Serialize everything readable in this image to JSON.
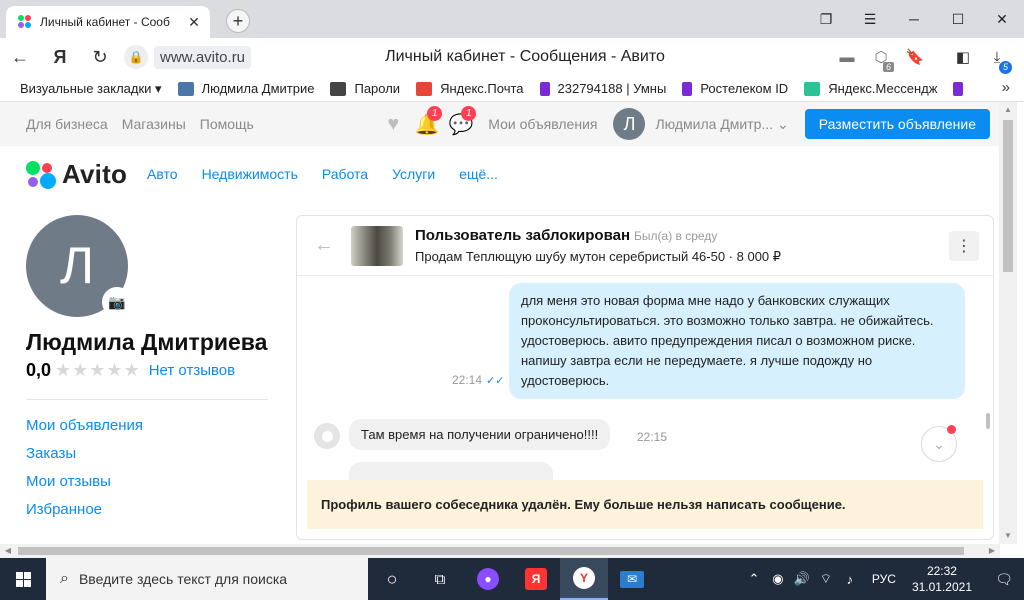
{
  "browser": {
    "tab_title": "Личный кабинет - Сооб",
    "domain": "www.avito.ru",
    "page_title": "Личный кабинет - Сообщения - Авито",
    "badge_6": "6",
    "badge_5": "5",
    "bookmarks": [
      {
        "label": "Визуальные закладки ▾",
        "color": ""
      },
      {
        "label": "Людмила Дмитрие",
        "color": "#4a76a8"
      },
      {
        "label": "Пароли",
        "color": "#444444"
      },
      {
        "label": "Яндекс.Почта",
        "color": "#e6453a"
      },
      {
        "label": "232794188 | Умны",
        "color": "#7b2bd6"
      },
      {
        "label": "Ростелеком ID",
        "color": "#7b2bd6"
      },
      {
        "label": "Яндекс.Мессендж",
        "color": "#2cc295"
      }
    ]
  },
  "avito": {
    "top_links": [
      "Для бизнеса",
      "Магазины",
      "Помощь"
    ],
    "fav_badge": "1",
    "msg_badge": "1",
    "my_ads": "Мои объявления",
    "avatar_letter": "Л",
    "user_name": "Людмила Дмитр...",
    "post_button": "Разместить объявление",
    "logo_text": "Avito",
    "categories": [
      "Авто",
      "Недвижимость",
      "Работа",
      "Услуги",
      "ещё..."
    ]
  },
  "profile": {
    "avatar_letter": "Л",
    "name": "Людмила Дмитриева",
    "rating": "0,0",
    "stars": "★★★★★",
    "reviews_link": "Нет отзывов",
    "menu": [
      "Мои объявления",
      "Заказы",
      "Мои отзывы",
      "Избранное"
    ]
  },
  "chat": {
    "title": "Пользователь заблокирован",
    "status": "Был(а) в среду",
    "subtitle": "Продам Теплющую шубу мутон серебристый 46-50 · 8 000 ₽",
    "out_message": "для меня это новая форма мне надо у банковских служащих проконсультироваться. это возможно только завтра. не обижайтесь. удостоверюсь. авито предупреждения писал о возможном риске. напишу завтра если не передумаете. я лучше подожду но удостоверюсь.",
    "out_time": "22:14",
    "in_message": "Там время на получении ограничено!!!!",
    "in_time": "22:15",
    "notice": "Профиль вашего собеседника удалён. Ему больше нельзя написать сообщение."
  },
  "taskbar": {
    "search_placeholder": "Введите здесь текст для поиска",
    "lang": "РУС",
    "time": "22:32",
    "date": "31.01.2021"
  }
}
